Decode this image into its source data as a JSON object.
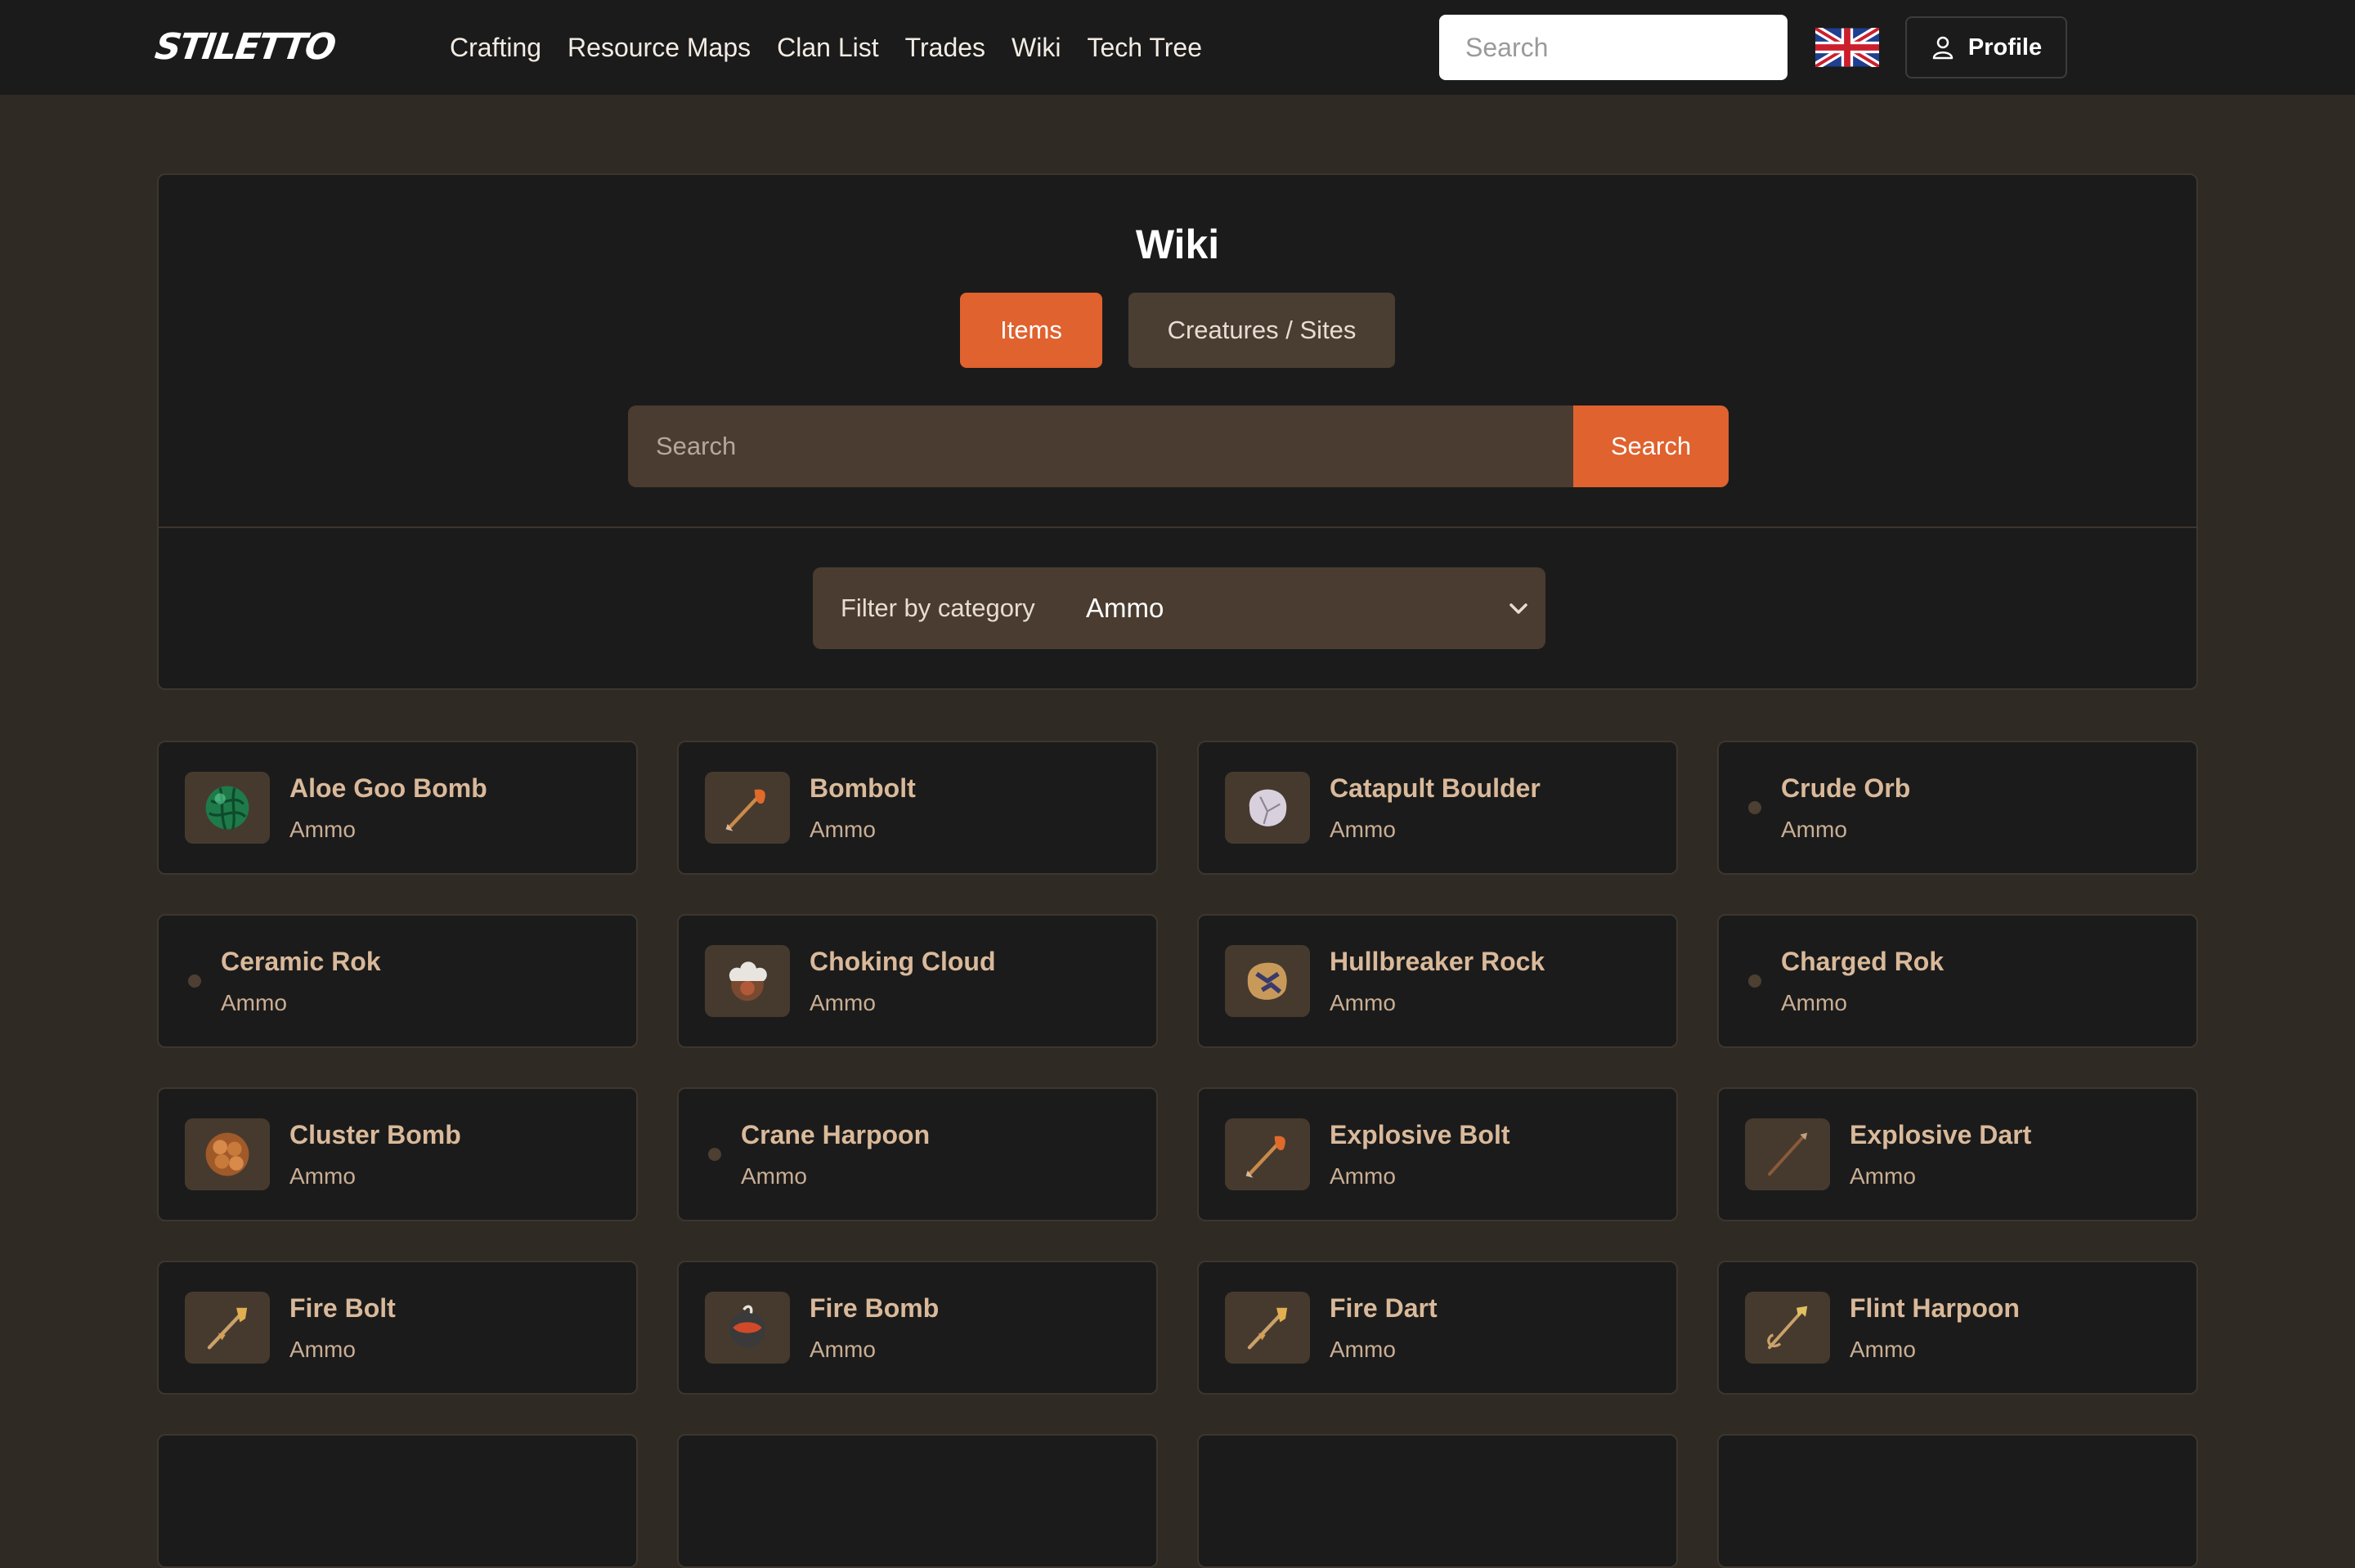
{
  "nav": {
    "logo_text": "STILETTO",
    "links": [
      "Crafting",
      "Resource Maps",
      "Clan List",
      "Trades",
      "Wiki",
      "Tech Tree"
    ],
    "search_placeholder": "Search",
    "profile_label": "Profile",
    "language": "English (UK)"
  },
  "panel": {
    "title": "Wiki",
    "tabs": [
      "Items",
      "Creatures / Sites"
    ],
    "active_tab": "Items",
    "search_placeholder": "Search",
    "search_button": "Search",
    "filter_label": "Filter by category",
    "filter_value": "Ammo"
  },
  "items": [
    {
      "name": "Aloe Goo Bomb",
      "category": "Ammo",
      "icon": "green-bomb"
    },
    {
      "name": "Bombolt",
      "category": "Ammo",
      "icon": "bolt"
    },
    {
      "name": "Catapult Boulder",
      "category": "Ammo",
      "icon": "boulder"
    },
    {
      "name": "Crude Orb",
      "category": "Ammo",
      "icon": ""
    },
    {
      "name": "Ceramic Rok",
      "category": "Ammo",
      "icon": ""
    },
    {
      "name": "Choking Cloud",
      "category": "Ammo",
      "icon": "cloud-bomb"
    },
    {
      "name": "Hullbreaker Rock",
      "category": "Ammo",
      "icon": "rock"
    },
    {
      "name": "Charged Rok",
      "category": "Ammo",
      "icon": ""
    },
    {
      "name": "Cluster Bomb",
      "category": "Ammo",
      "icon": "cluster-bomb"
    },
    {
      "name": "Crane Harpoon",
      "category": "Ammo",
      "icon": ""
    },
    {
      "name": "Explosive Bolt",
      "category": "Ammo",
      "icon": "bolt"
    },
    {
      "name": "Explosive Dart",
      "category": "Ammo",
      "icon": "dart"
    },
    {
      "name": "Fire Bolt",
      "category": "Ammo",
      "icon": "fire-bolt"
    },
    {
      "name": "Fire Bomb",
      "category": "Ammo",
      "icon": "fire-bomb"
    },
    {
      "name": "Fire Dart",
      "category": "Ammo",
      "icon": "fire-bolt"
    },
    {
      "name": "Flint Harpoon",
      "category": "Ammo",
      "icon": "harpoon"
    }
  ],
  "colors": {
    "accent": "#e0622e",
    "background": "#2f2a24",
    "panel": "#1b1b1b",
    "input": "#4a3c30",
    "item_name": "#d9b99a"
  }
}
